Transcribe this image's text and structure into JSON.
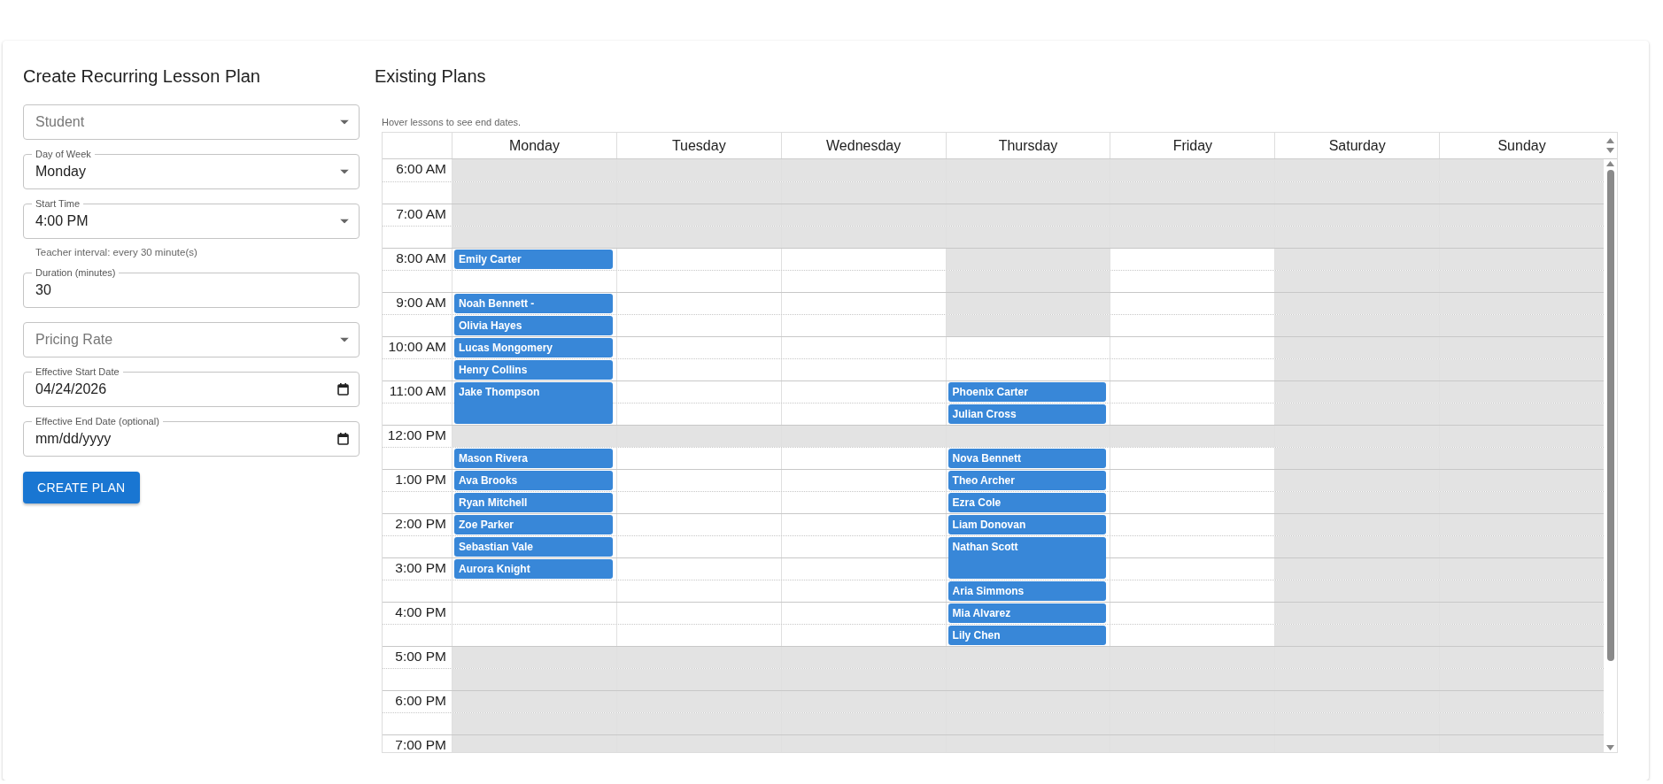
{
  "form": {
    "title": "Create Recurring Lesson Plan",
    "fields": [
      {
        "kind": "select",
        "placeholder": "Student"
      },
      {
        "kind": "select",
        "label": "Day of Week",
        "value": "Monday"
      },
      {
        "kind": "select",
        "label": "Start Time",
        "value": "4:00 PM",
        "helper": "Teacher interval: every 30 minute(s)"
      },
      {
        "kind": "text",
        "label": "Duration (minutes)",
        "value": "30"
      },
      {
        "kind": "select",
        "placeholder": "Pricing Rate"
      },
      {
        "kind": "date",
        "label": "Effective Start Date",
        "value": "04/24/2026"
      },
      {
        "kind": "date",
        "label": "Effective End Date (optional)",
        "placeholder": "mm/dd/yyyy"
      }
    ],
    "button": "CREATE PLAN"
  },
  "plans": {
    "title": "Existing Plans",
    "hint": "Hover lessons to see end dates.",
    "days": [
      "Monday",
      "Tuesday",
      "Wednesday",
      "Thursday",
      "Friday",
      "Saturday",
      "Sunday"
    ],
    "rows": [
      {
        "time": "6:00 AM",
        "cells": [
          {
            "open": false
          },
          {
            "open": false
          },
          {
            "open": false
          },
          {
            "open": false
          },
          {
            "open": false
          },
          {
            "open": false
          },
          {
            "open": false
          }
        ]
      },
      {
        "cells": [
          {
            "open": false
          },
          {
            "open": false
          },
          {
            "open": false
          },
          {
            "open": false
          },
          {
            "open": false
          },
          {
            "open": false
          },
          {
            "open": false
          }
        ]
      },
      {
        "time": "7:00 AM",
        "cells": [
          {
            "open": false
          },
          {
            "open": false
          },
          {
            "open": false
          },
          {
            "open": false
          },
          {
            "open": false
          },
          {
            "open": false
          },
          {
            "open": false
          }
        ]
      },
      {
        "cells": [
          {
            "open": false
          },
          {
            "open": false
          },
          {
            "open": false
          },
          {
            "open": false
          },
          {
            "open": false
          },
          {
            "open": false
          },
          {
            "open": false
          }
        ]
      },
      {
        "time": "8:00 AM",
        "cells": [
          {
            "open": true,
            "lesson": {
              "name": "Emily Carter",
              "kind": "single"
            }
          },
          {
            "open": true
          },
          {
            "open": true
          },
          {
            "open": false
          },
          {
            "open": true
          },
          {
            "open": false
          },
          {
            "open": false
          }
        ]
      },
      {
        "cells": [
          {
            "open": true
          },
          {
            "open": true
          },
          {
            "open": true
          },
          {
            "open": false
          },
          {
            "open": true
          },
          {
            "open": false
          },
          {
            "open": false
          }
        ]
      },
      {
        "time": "9:00 AM",
        "cells": [
          {
            "open": true,
            "lesson": {
              "name": "Noah Bennett -",
              "kind": "single"
            }
          },
          {
            "open": true
          },
          {
            "open": true
          },
          {
            "open": false
          },
          {
            "open": true
          },
          {
            "open": false
          },
          {
            "open": false
          }
        ]
      },
      {
        "cells": [
          {
            "open": true,
            "lesson": {
              "name": "Olivia Hayes",
              "kind": "single"
            }
          },
          {
            "open": true
          },
          {
            "open": true
          },
          {
            "open": false
          },
          {
            "open": true
          },
          {
            "open": false
          },
          {
            "open": false
          }
        ]
      },
      {
        "time": "10:00 AM",
        "cells": [
          {
            "open": true,
            "lesson": {
              "name": "Lucas Mongomery",
              "kind": "single"
            }
          },
          {
            "open": true
          },
          {
            "open": true
          },
          {
            "open": true
          },
          {
            "open": true
          },
          {
            "open": false
          },
          {
            "open": false
          }
        ]
      },
      {
        "cells": [
          {
            "open": true,
            "lesson": {
              "name": "Henry Collins",
              "kind": "single"
            }
          },
          {
            "open": true
          },
          {
            "open": true
          },
          {
            "open": true
          },
          {
            "open": true
          },
          {
            "open": false
          },
          {
            "open": false
          }
        ]
      },
      {
        "time": "11:00 AM",
        "cells": [
          {
            "open": true,
            "lesson": {
              "name": "Jake Thompson",
              "kind": "double"
            }
          },
          {
            "open": true
          },
          {
            "open": true
          },
          {
            "open": true,
            "lesson": {
              "name": "Phoenix Carter",
              "kind": "single"
            }
          },
          {
            "open": true
          },
          {
            "open": false
          },
          {
            "open": false
          }
        ]
      },
      {
        "cells": [
          {
            "open": true
          },
          {
            "open": true
          },
          {
            "open": true
          },
          {
            "open": true,
            "lesson": {
              "name": "Julian Cross",
              "kind": "single"
            }
          },
          {
            "open": true
          },
          {
            "open": false
          },
          {
            "open": false
          }
        ]
      },
      {
        "time": "12:00 PM",
        "cells": [
          {
            "open": false
          },
          {
            "open": false
          },
          {
            "open": false
          },
          {
            "open": false
          },
          {
            "open": false
          },
          {
            "open": false
          },
          {
            "open": false
          }
        ]
      },
      {
        "cells": [
          {
            "open": true,
            "lesson": {
              "name": "Mason Rivera",
              "kind": "single"
            }
          },
          {
            "open": true
          },
          {
            "open": true
          },
          {
            "open": true,
            "lesson": {
              "name": "Nova Bennett",
              "kind": "single"
            }
          },
          {
            "open": true
          },
          {
            "open": false
          },
          {
            "open": false
          }
        ]
      },
      {
        "time": "1:00 PM",
        "cells": [
          {
            "open": true,
            "lesson": {
              "name": "Ava Brooks",
              "kind": "single"
            }
          },
          {
            "open": true
          },
          {
            "open": true
          },
          {
            "open": true,
            "lesson": {
              "name": "Theo Archer",
              "kind": "single"
            }
          },
          {
            "open": true
          },
          {
            "open": false
          },
          {
            "open": false
          }
        ]
      },
      {
        "cells": [
          {
            "open": true,
            "lesson": {
              "name": "Ryan Mitchell",
              "kind": "single"
            }
          },
          {
            "open": true
          },
          {
            "open": true
          },
          {
            "open": true,
            "lesson": {
              "name": "Ezra Cole",
              "kind": "single"
            }
          },
          {
            "open": true
          },
          {
            "open": false
          },
          {
            "open": false
          }
        ]
      },
      {
        "time": "2:00 PM",
        "cells": [
          {
            "open": true,
            "lesson": {
              "name": "Zoe Parker",
              "kind": "single"
            }
          },
          {
            "open": true
          },
          {
            "open": true
          },
          {
            "open": true,
            "lesson": {
              "name": "Liam Donovan",
              "kind": "single"
            }
          },
          {
            "open": true
          },
          {
            "open": false
          },
          {
            "open": false
          }
        ]
      },
      {
        "cells": [
          {
            "open": true,
            "lesson": {
              "name": "Sebastian Vale",
              "kind": "single"
            }
          },
          {
            "open": true
          },
          {
            "open": true
          },
          {
            "open": true,
            "lesson": {
              "name": "Nathan Scott",
              "kind": "double"
            }
          },
          {
            "open": true
          },
          {
            "open": false
          },
          {
            "open": false
          }
        ]
      },
      {
        "time": "3:00 PM",
        "cells": [
          {
            "open": true,
            "lesson": {
              "name": "Aurora Knight",
              "kind": "single"
            }
          },
          {
            "open": true
          },
          {
            "open": true
          },
          {
            "open": true
          },
          {
            "open": true
          },
          {
            "open": false
          },
          {
            "open": false
          }
        ]
      },
      {
        "cells": [
          {
            "open": true
          },
          {
            "open": true
          },
          {
            "open": true
          },
          {
            "open": true,
            "lesson": {
              "name": "Aria Simmons",
              "kind": "single"
            }
          },
          {
            "open": true
          },
          {
            "open": false
          },
          {
            "open": false
          }
        ]
      },
      {
        "time": "4:00 PM",
        "cells": [
          {
            "open": true
          },
          {
            "open": true
          },
          {
            "open": true
          },
          {
            "open": true,
            "lesson": {
              "name": "Mia Alvarez",
              "kind": "single"
            }
          },
          {
            "open": true
          },
          {
            "open": false
          },
          {
            "open": false
          }
        ]
      },
      {
        "cells": [
          {
            "open": true
          },
          {
            "open": true
          },
          {
            "open": true
          },
          {
            "open": true,
            "lesson": {
              "name": "Lily Chen",
              "kind": "single"
            }
          },
          {
            "open": true
          },
          {
            "open": false
          },
          {
            "open": false
          }
        ]
      },
      {
        "time": "5:00 PM",
        "cells": [
          {
            "open": false
          },
          {
            "open": false
          },
          {
            "open": false
          },
          {
            "open": false
          },
          {
            "open": false
          },
          {
            "open": false
          },
          {
            "open": false
          }
        ]
      },
      {
        "cells": [
          {
            "open": false
          },
          {
            "open": false
          },
          {
            "open": false
          },
          {
            "open": false
          },
          {
            "open": false
          },
          {
            "open": false
          },
          {
            "open": false
          }
        ]
      },
      {
        "time": "6:00 PM",
        "cells": [
          {
            "open": false
          },
          {
            "open": false
          },
          {
            "open": false
          },
          {
            "open": false
          },
          {
            "open": false
          },
          {
            "open": false
          },
          {
            "open": false
          }
        ]
      },
      {
        "cells": [
          {
            "open": false
          },
          {
            "open": false
          },
          {
            "open": false
          },
          {
            "open": false
          },
          {
            "open": false
          },
          {
            "open": false
          },
          {
            "open": false
          }
        ]
      },
      {
        "time": "7:00 PM",
        "cells": [
          {
            "open": false
          },
          {
            "open": false
          },
          {
            "open": false
          },
          {
            "open": false
          },
          {
            "open": false
          },
          {
            "open": false
          },
          {
            "open": false
          }
        ]
      }
    ]
  }
}
